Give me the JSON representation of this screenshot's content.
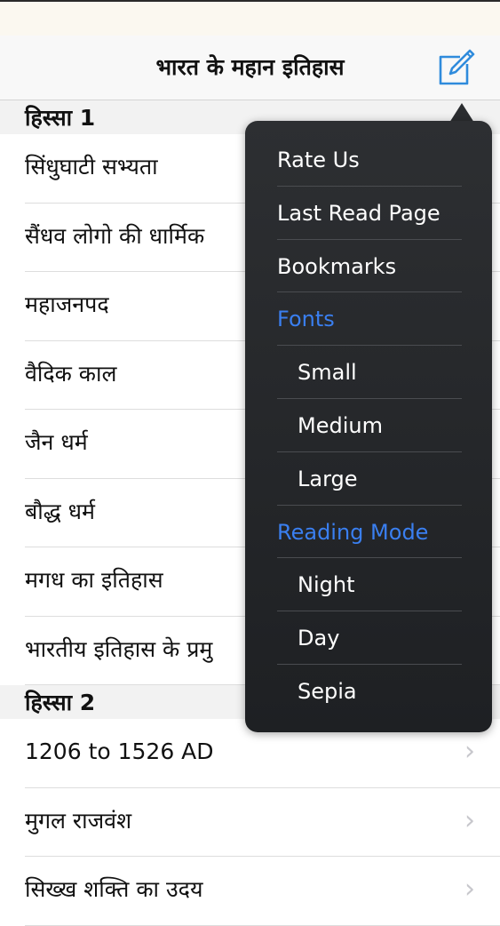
{
  "nav": {
    "title": "भारत के महान इतिहास",
    "compose_icon": "compose-icon"
  },
  "sections": [
    {
      "header": "हिस्सा 1",
      "rows": [
        "सिंधुघाटी सभ्यता",
        "सैंधव लोगो की धार्मिक",
        "महाजनपद",
        "वैदिक काल",
        "जैन धर्म",
        "बौद्ध धर्म",
        "मगध का इतिहास",
        "भारतीय इतिहास के प्रमु"
      ]
    },
    {
      "header": "हिस्सा 2",
      "rows": [
        "1206 to 1526 AD",
        "मुगल राजवंश",
        "सिख्ख शक्ति का उदय"
      ]
    }
  ],
  "menu": {
    "items": [
      {
        "label": "Rate Us",
        "type": "action"
      },
      {
        "label": "Last Read Page",
        "type": "action"
      },
      {
        "label": "Bookmarks",
        "type": "action"
      },
      {
        "label": "Fonts",
        "type": "header"
      },
      {
        "label": "Small",
        "type": "option"
      },
      {
        "label": "Medium",
        "type": "option"
      },
      {
        "label": "Large",
        "type": "option"
      },
      {
        "label": "Reading Mode",
        "type": "header"
      },
      {
        "label": "Night",
        "type": "option"
      },
      {
        "label": "Day",
        "type": "option"
      },
      {
        "label": "Sepia",
        "type": "option"
      }
    ]
  },
  "colors": {
    "accent": "#3a7ff0",
    "compose": "#2f8bdc",
    "popover_bg": "#2b2d30"
  }
}
